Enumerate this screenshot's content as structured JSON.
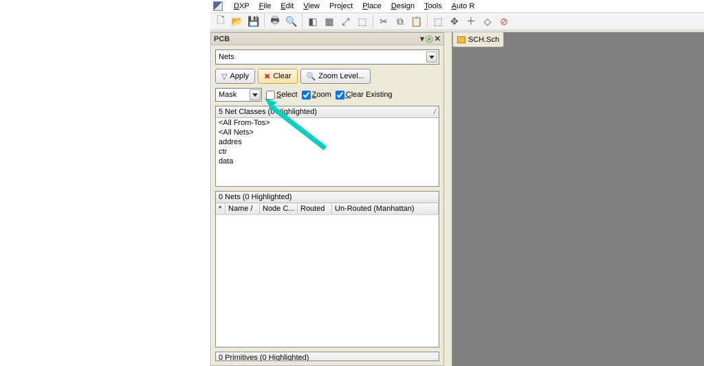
{
  "menu": {
    "app": "DXP",
    "items": [
      "File",
      "Edit",
      "View",
      "Project",
      "Place",
      "Design",
      "Tools",
      "Auto R"
    ]
  },
  "panel": {
    "title": "PCB",
    "main_dropdown": "Nets",
    "buttons": {
      "apply": "Apply",
      "clear": "Clear",
      "zoom": "Zoom Level..."
    },
    "mask_dropdown": "Mask",
    "checks": {
      "select": "Select",
      "zoom": "Zoom",
      "clear_existing": "Clear Existing"
    },
    "net_classes": {
      "header": "5 Net Classes (0 Highlighted)",
      "sort_indicator": "/",
      "items": [
        "<All From-Tos>",
        "<All Nets>",
        "addres",
        "ctr",
        "data"
      ]
    },
    "nets": {
      "header": "0 Nets (0 Highlighted)",
      "columns": [
        "*",
        "Name  /",
        "Node C...",
        "Routed",
        "Un-Routed (Manhattan)"
      ]
    },
    "primitives": {
      "header": "0 Primitives (0 Highlighted)"
    }
  },
  "document_tab": "SCH.Sch"
}
